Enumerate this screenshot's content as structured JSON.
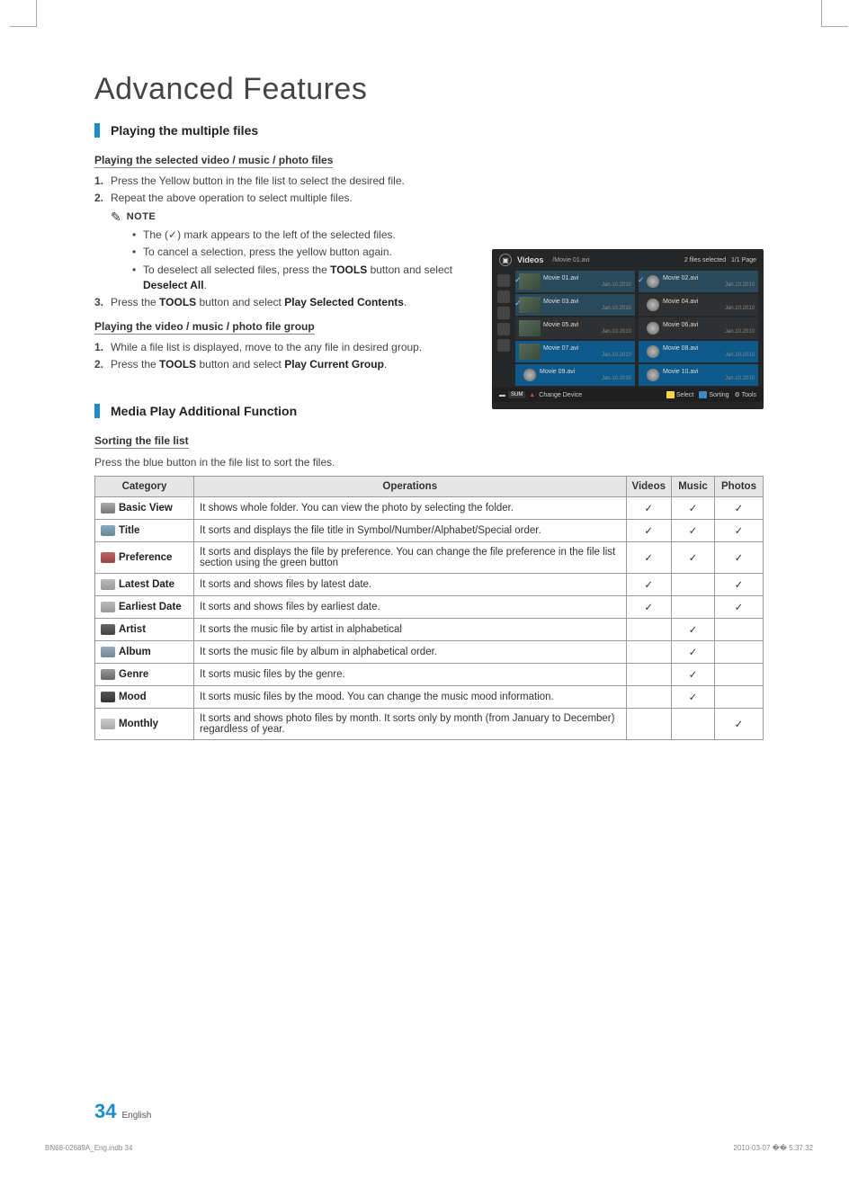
{
  "page": {
    "title": "Advanced Features",
    "number": "34",
    "lang": "English"
  },
  "sections": {
    "multi": {
      "heading": "Playing the multiple files",
      "sub1": "Playing the selected video / music / photo files",
      "steps1": [
        "Press the Yellow button in the file list to select the desired file.",
        "Repeat the above operation to select multiple files."
      ],
      "noteLabel": "NOTE",
      "notes": [
        "The (✓) mark appears to the left of the selected files.",
        "To cancel a selection, press the yellow button again.",
        "To deselect all selected files, press the TOOLS button and select Deselect All."
      ],
      "notesPart3a": "To deselect all selected files, press the ",
      "notesPart3b": "TOOLS",
      "notesPart3c": " button and select ",
      "notesPart3d": "Deselect All",
      "notesPart3e": ".",
      "step3a": "Press the ",
      "step3b": "TOOLS",
      "step3c": " button and select ",
      "step3d": "Play Selected Contents",
      "step3e": ".",
      "sub2": "Playing the video / music / photo file group",
      "steps2": [
        "While a file list is displayed, move to the any file in desired group."
      ],
      "step22a": "Press the ",
      "step22b": "TOOLS",
      "step22c": " button and select ",
      "step22d": "Play Current Group",
      "step22e": "."
    },
    "additional": {
      "heading": "Media Play Additional Function",
      "sub": "Sorting the file list",
      "intro": "Press the blue button in the file list to sort the files."
    }
  },
  "screenshot": {
    "section": "Videos",
    "path": "/Movie 01.avi",
    "status": "2 files selected",
    "page": "1/1 Page",
    "items": [
      {
        "name": "Movie 01.avi",
        "date": "Jan.10.2010",
        "thumb": true,
        "checked": true,
        "sel": true
      },
      {
        "name": "Movie 02.avi",
        "date": "Jan.10.2010",
        "thumb": false,
        "checked": true,
        "sel": true
      },
      {
        "name": "Movie 03.avi",
        "date": "Jan.10.2010",
        "thumb": true,
        "checked": true,
        "sel": true
      },
      {
        "name": "Movie 04.avi",
        "date": "Jan.10.2010",
        "thumb": false,
        "checked": false,
        "sel": false
      },
      {
        "name": "Movie 05.avi",
        "date": "Jan.10.2010",
        "thumb": true,
        "checked": false,
        "sel": false
      },
      {
        "name": "Movie 06.avi",
        "date": "Jan.10.2010",
        "thumb": false,
        "checked": false,
        "sel": false
      },
      {
        "name": "Movie 07.avi",
        "date": "Jan.10.2010",
        "thumb": true,
        "checked": false,
        "hl": true
      },
      {
        "name": "Movie 08.avi",
        "date": "Jan.10.2010",
        "thumb": false,
        "checked": false,
        "hl": true
      },
      {
        "name": "Movie 09.avi",
        "date": "Jan.10.2010",
        "thumb": false,
        "checked": false,
        "hl": true
      },
      {
        "name": "Movie 10.avi",
        "date": "Jan.10.2010",
        "thumb": false,
        "checked": false,
        "hl": true
      }
    ],
    "bottom": {
      "device": "SUM",
      "change": "Change Device",
      "select": "Select",
      "sorting": "Sorting",
      "tools": "Tools"
    }
  },
  "table": {
    "headers": {
      "category": "Category",
      "operations": "Operations",
      "videos": "Videos",
      "music": "Music",
      "photos": "Photos"
    },
    "rows": [
      {
        "icon": "ci-folder",
        "name": "Basic View",
        "op": "It shows whole folder. You can view the photo by selecting the folder.",
        "v": "✓",
        "m": "✓",
        "p": "✓"
      },
      {
        "icon": "ci-abc",
        "name": "Title",
        "op": "It sorts and displays the file title in Symbol/Number/Alphabet/Special order.",
        "v": "✓",
        "m": "✓",
        "p": "✓"
      },
      {
        "icon": "ci-star",
        "name": "Preference",
        "op": "It sorts and displays the file by preference. You can change the file preference in the file list section using the green button",
        "v": "✓",
        "m": "✓",
        "p": "✓"
      },
      {
        "icon": "ci-cal",
        "name": "Latest Date",
        "op": "It sorts and shows files by latest date.",
        "v": "✓",
        "m": "",
        "p": "✓"
      },
      {
        "icon": "ci-calr",
        "name": "Earliest Date",
        "op": "It sorts and shows files by earliest date.",
        "v": "✓",
        "m": "",
        "p": "✓"
      },
      {
        "icon": "ci-artist",
        "name": "Artist",
        "op": "It sorts the music file by artist in alphabetical",
        "v": "",
        "m": "✓",
        "p": ""
      },
      {
        "icon": "ci-album",
        "name": "Album",
        "op": "It sorts the music file by album in alphabetical order.",
        "v": "",
        "m": "✓",
        "p": ""
      },
      {
        "icon": "ci-genre",
        "name": "Genre",
        "op": "It sorts music files by the genre.",
        "v": "",
        "m": "✓",
        "p": ""
      },
      {
        "icon": "ci-mood",
        "name": "Mood",
        "op": "It sorts music files by the mood. You can change the music mood information.",
        "v": "",
        "m": "✓",
        "p": ""
      },
      {
        "icon": "ci-month",
        "name": "Monthly",
        "op": "It sorts and shows photo files by month. It sorts only by month (from January to December) regardless of year.",
        "v": "",
        "m": "",
        "p": "✓"
      }
    ]
  },
  "footline": {
    "left": "BN68-02689A_Eng.indb   34",
    "right": "2010-03-07   �� 5:37:32"
  }
}
